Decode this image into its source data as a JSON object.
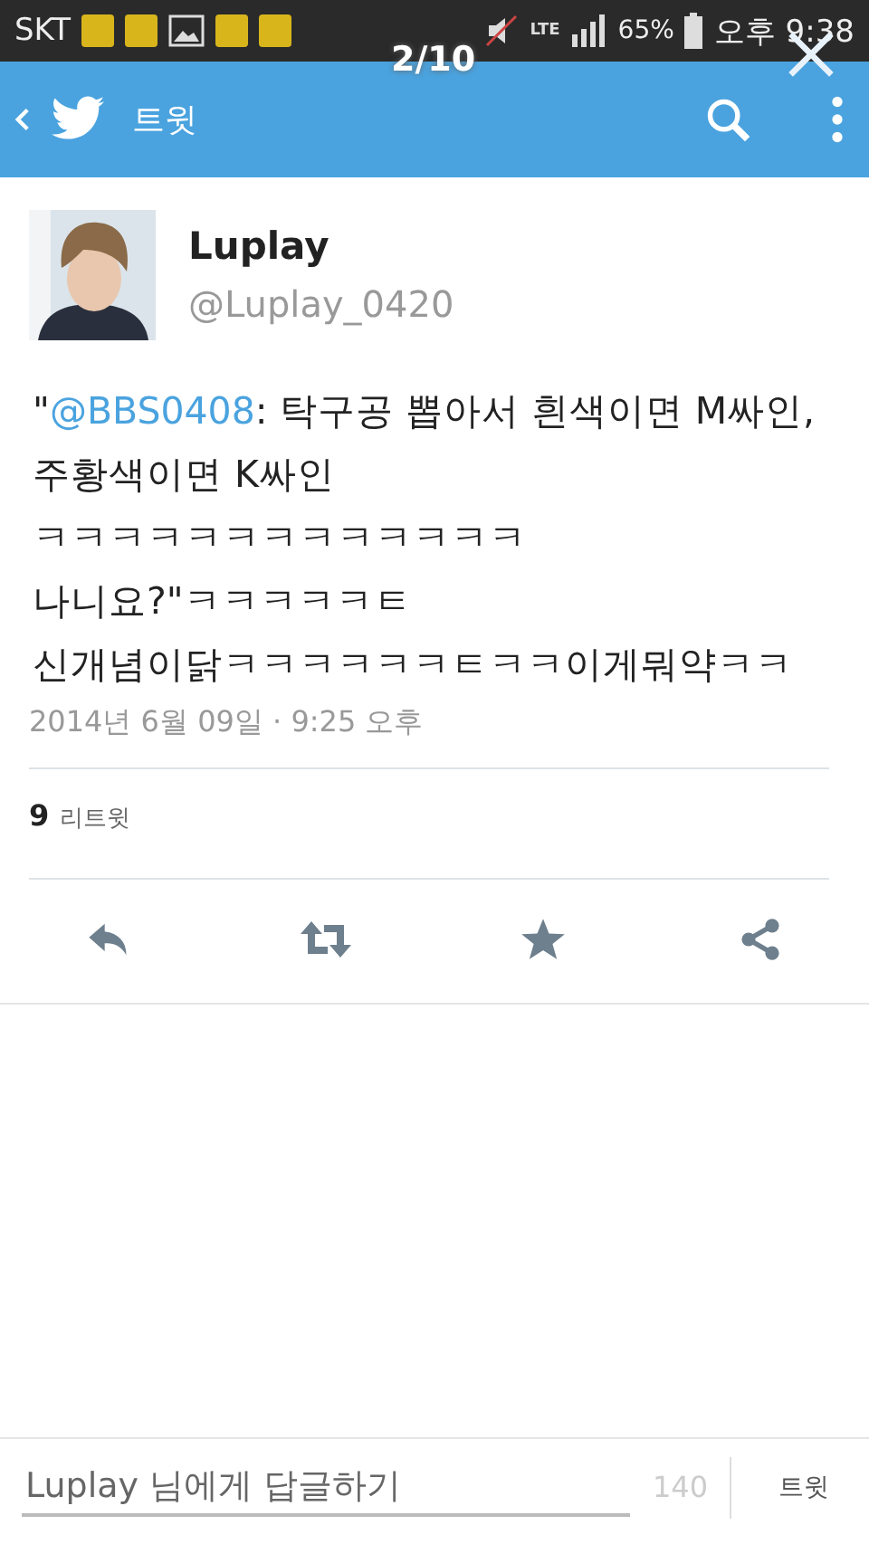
{
  "status_bar": {
    "carrier": "SKT",
    "battery_percent": "65%",
    "time": "오후 9:38",
    "network": "LTE"
  },
  "viewer_overlay": {
    "counter": "2/10"
  },
  "header": {
    "title": "트윗"
  },
  "tweet": {
    "name": "Luplay",
    "handle": "@Luplay_0420",
    "text_before": "\"",
    "mention": "@BBS0408",
    "text_after": ": 탁구공 뽑아서 흰색이면 M싸인, 주황색이면 K싸인\nㅋㅋㅋㅋㅋㅋㅋㅋㅋㅋㅋㅋㅋ\n나니요?\"ㅋㅋㅋㅋㅋㅌ\n신개념이닭ㅋㅋㅋㅋㅋㅋㅌㅋㅋ이게뭐약ㅋㅋ",
    "timestamp": "2014년 6월 09일 · 9:25 오후",
    "retweet_count": "9",
    "retweet_label": "리트윗"
  },
  "reply_bar": {
    "placeholder": "Luplay 님에게 답글하기",
    "char_count": "140",
    "send_label": "트윗"
  }
}
